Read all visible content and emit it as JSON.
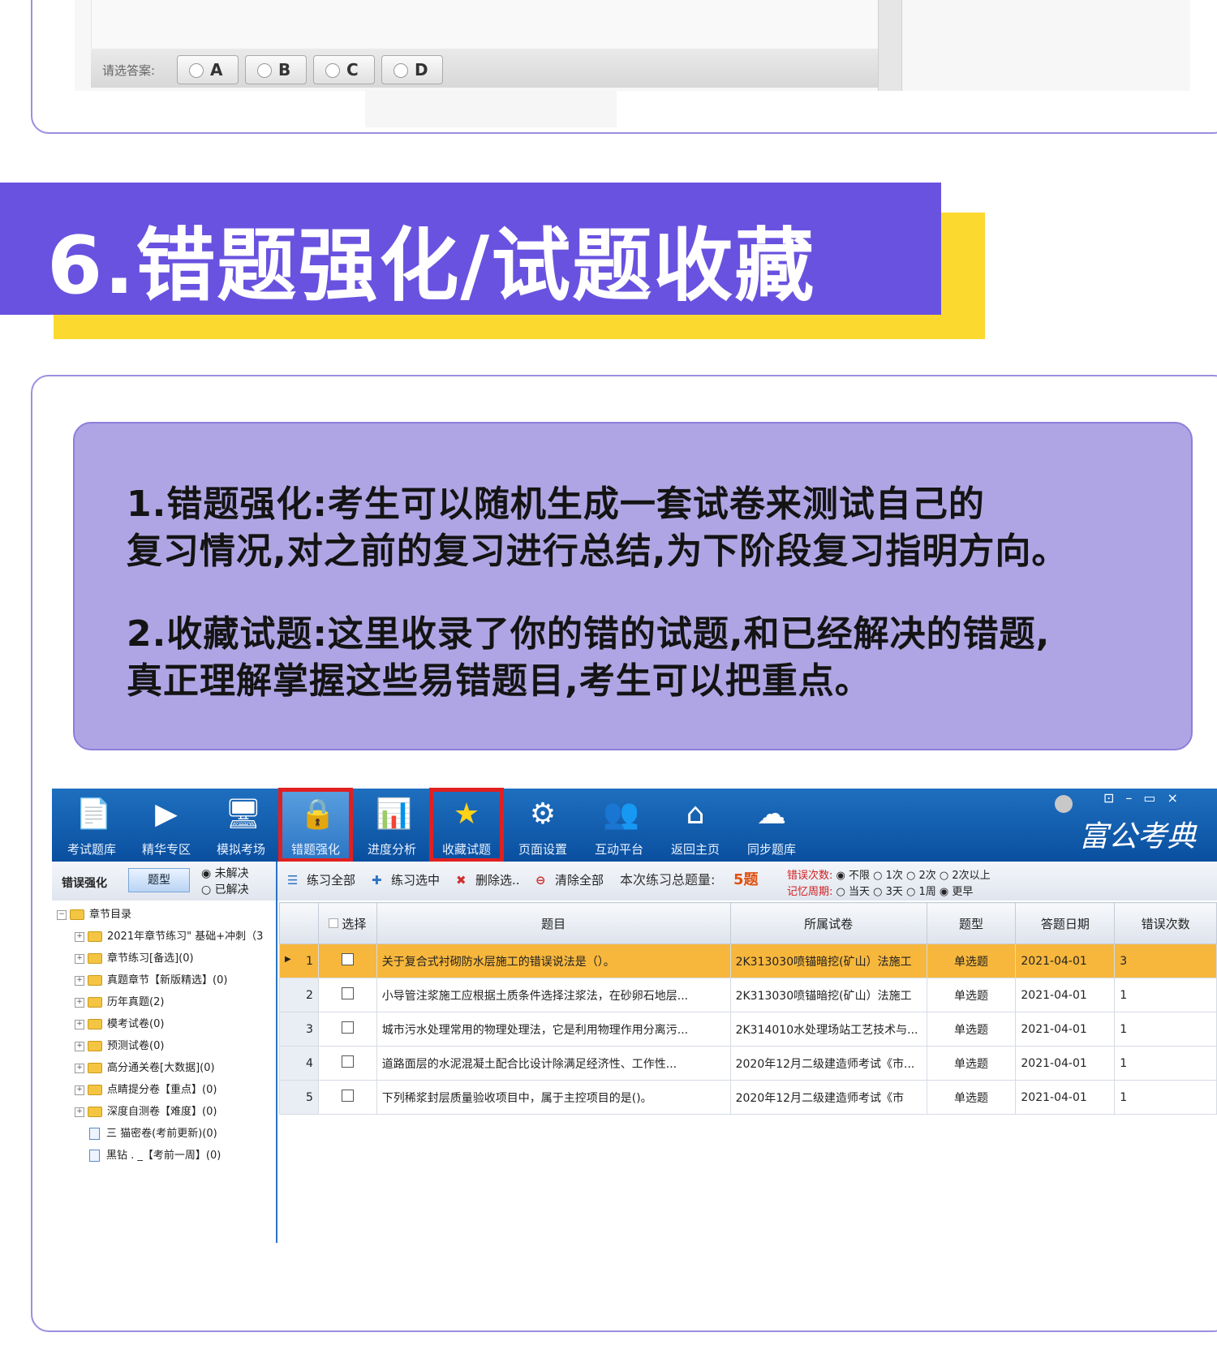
{
  "top_card": {
    "answer_label": "请选答案:",
    "options": [
      "A",
      "B",
      "C",
      "D"
    ]
  },
  "heading": {
    "title": "6.错题强化/试题收藏"
  },
  "description": {
    "line1": "1.错题强化:考生可以随机生成一套试卷来测试自己的",
    "line2": "复习情况,对之前的复习进行总结,为下阶段复习指明方向。",
    "line3": "2.收藏试题:这里收录了你的错的试题,和已经解决的错题,",
    "line4": "真正理解掌握这些易错题目,考生可以把重点。"
  },
  "app": {
    "brand": "富公考典",
    "window_controls": "⊡–▭×",
    "toolbar": [
      {
        "label": "考试题库",
        "icon": "book-icon",
        "glyph": "📄"
      },
      {
        "label": "精华专区",
        "icon": "play-icon",
        "glyph": "▶"
      },
      {
        "label": "模拟考场",
        "icon": "monitor-icon",
        "glyph": "🖥"
      },
      {
        "label": "错题强化",
        "icon": "lock-folder-icon",
        "glyph": "🔒"
      },
      {
        "label": "进度分析",
        "icon": "chart-icon",
        "glyph": "📊"
      },
      {
        "label": "收藏试题",
        "icon": "star-icon",
        "glyph": "★"
      },
      {
        "label": "页面设置",
        "icon": "gear-icon",
        "glyph": "⚙"
      },
      {
        "label": "互动平台",
        "icon": "users-icon",
        "glyph": "👥"
      },
      {
        "label": "返回主页",
        "icon": "home-icon",
        "glyph": "⌂"
      },
      {
        "label": "同步题库",
        "icon": "cloud-sync-icon",
        "glyph": "☁"
      }
    ],
    "left_panel": {
      "title": "错误强化",
      "type_button": "题型",
      "radio_unsolved": "◉ 未解决",
      "radio_solved": "○ 已解决",
      "tree": [
        "章节目录",
        "2021年章节练习\" 基础+冲刺（3",
        "章节练习[备选](0)",
        "真题章节【新版精选】(0)",
        "历年真题(2)",
        "模考试卷(0)",
        "预测试卷(0)",
        "高分通关卷[大数据](0)",
        "点睛提分卷【重点】(0)",
        "深度自测卷【难度】(0)",
        "三 猫密卷(考前更新)(0)",
        "黑钻 . _【考前一周】(0)"
      ]
    },
    "action_bar": {
      "practice_all": "练习全部",
      "practice_selected": "练习选中",
      "delete_selected": "删除选..",
      "clear_all": "清除全部",
      "total_label": "本次练习总题量:",
      "total_value": "5题",
      "error_count_label": "错误次数:",
      "error_count_options": "◉ 不限 ○ 1次 ○ 2次 ○ 2次以上",
      "memory_label": "记忆周期:",
      "memory_options": "○ 当天 ○ 3天 ○ 1周 ◉ 更早"
    },
    "table": {
      "headers": [
        "",
        "选择",
        "题目",
        "所属试卷",
        "题型",
        "答题日期",
        "错误次数"
      ],
      "rows": [
        {
          "no": "1",
          "question": "关于复合式衬砌防水层施工的错误说法是（）。",
          "paper": "2K313030喷锚暗挖(矿山）法施工",
          "type": "单选题",
          "date": "2021-04-01",
          "errors": "3"
        },
        {
          "no": "2",
          "question": "小导管注浆施工应根据土质条件选择注浆法，在砂卵石地层...",
          "paper": "2K313030喷锚暗挖(矿山）法施工",
          "type": "单选题",
          "date": "2021-04-01",
          "errors": "1"
        },
        {
          "no": "3",
          "question": "城市污水处理常用的物理处理法，它是利用物理作用分离污...",
          "paper": "2K314010水处理场站工艺技术与...",
          "type": "单选题",
          "date": "2021-04-01",
          "errors": "1"
        },
        {
          "no": "4",
          "question": "道路面层的水泥混凝土配合比设计除满足经济性、工作性...",
          "paper": "2020年12月二级建造师考试《市...",
          "type": "单选题",
          "date": "2021-04-01",
          "errors": "1"
        },
        {
          "no": "5",
          "question": "下列稀浆封层质量验收项目中，属于主控项目的是()。",
          "paper": "2020年12月二级建造师考试《市",
          "type": "单选题",
          "date": "2021-04-01",
          "errors": "1"
        }
      ]
    }
  }
}
